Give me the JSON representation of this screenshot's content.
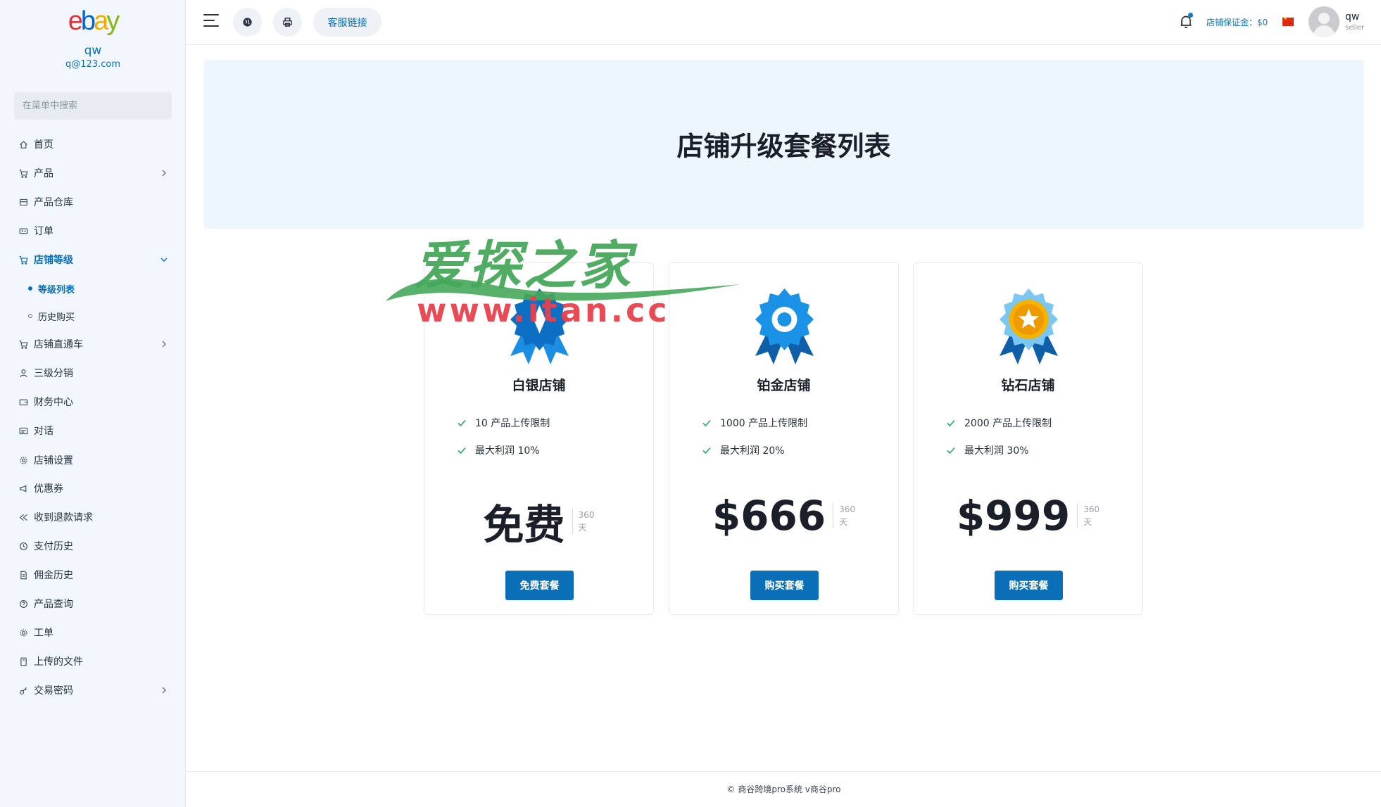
{
  "sidebar": {
    "user_name": "qw",
    "user_email": "q@123.com",
    "search_placeholder": "在菜单中搜索",
    "items": [
      {
        "label": "首页",
        "icon": "home-icon"
      },
      {
        "label": "产品",
        "icon": "cart-icon"
      },
      {
        "label": "产品仓库",
        "icon": "warehouse-icon"
      },
      {
        "label": "订单",
        "icon": "ticket-icon"
      },
      {
        "label": "店铺等级",
        "icon": "cart-icon"
      },
      {
        "label": "等级列表"
      },
      {
        "label": "历史购买"
      },
      {
        "label": "店铺直通车",
        "icon": "cart-icon"
      },
      {
        "label": "三级分销",
        "icon": "user-icon"
      },
      {
        "label": "财务中心",
        "icon": "wallet-icon"
      },
      {
        "label": "对话",
        "icon": "chat-icon"
      },
      {
        "label": "店铺设置",
        "icon": "gear-icon"
      },
      {
        "label": "优惠券",
        "icon": "megaphone-icon"
      },
      {
        "label": "收到退款请求",
        "icon": "refund-icon"
      },
      {
        "label": "支付历史",
        "icon": "history-icon"
      },
      {
        "label": "佣金历史",
        "icon": "document-icon"
      },
      {
        "label": "产品查询",
        "icon": "question-icon"
      },
      {
        "label": "工单",
        "icon": "gear-icon"
      },
      {
        "label": "上传的文件",
        "icon": "file-icon"
      },
      {
        "label": "交易密码",
        "icon": "key-icon"
      }
    ]
  },
  "header": {
    "customer_service_label": "客服链接",
    "deposit_label": "店铺保证金：$0",
    "user_name": "qw",
    "user_role": "seller"
  },
  "main": {
    "title": "店铺升级套餐列表",
    "watermark_cn": "爱探之家",
    "watermark_url": "www.itan.cc",
    "plans": [
      {
        "name": "白银店铺",
        "features": [
          "10 产品上传限制",
          "最大利润 10%"
        ],
        "price": "免费",
        "period_num": "360",
        "period_unit": "天",
        "button": "免费套餐"
      },
      {
        "name": "铂金店铺",
        "features": [
          "1000 产品上传限制",
          "最大利润 20%"
        ],
        "price": "$666",
        "period_num": "360",
        "period_unit": "天",
        "button": "购买套餐"
      },
      {
        "name": "钻石店铺",
        "features": [
          "2000 产品上传限制",
          "最大利润 30%"
        ],
        "price": "$999",
        "period_num": "360",
        "period_unit": "天",
        "button": "购买套餐"
      }
    ]
  },
  "footer": {
    "text": "© 商谷跨境pro系统 v商谷pro"
  },
  "colors": {
    "accent": "#0b6fb8",
    "sidebar_bg": "#f1f7fc",
    "hero_bg": "#eef6fd"
  }
}
